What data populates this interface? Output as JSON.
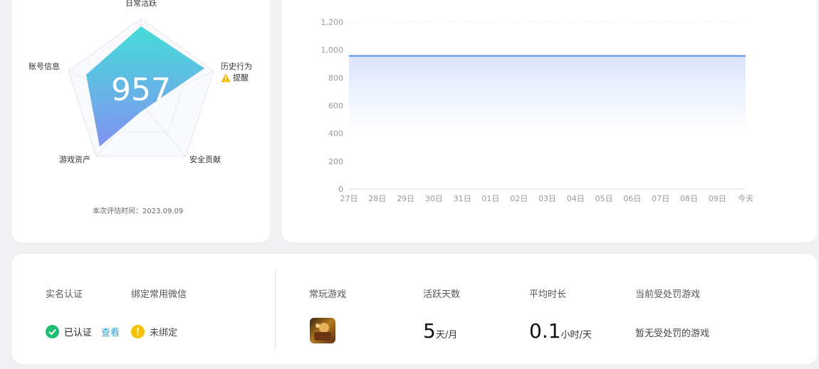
{
  "profile": {
    "score": "957",
    "radar_labels": {
      "daily_active": "日常活跃",
      "history": "历史行为",
      "reminder": "提醒",
      "security": "安全贡献",
      "assets": "游戏资产",
      "account": "账号信息"
    },
    "eval_date": "本次评估时间：2023.09.09",
    "colors": {
      "radar_top": "#3fdcd6",
      "radar_bottom": "#7e8ff2",
      "warning": "#f5b800"
    }
  },
  "chart_data": {
    "type": "area",
    "categories": [
      "27日",
      "28日",
      "29日",
      "30日",
      "31日",
      "01日",
      "02日",
      "03日",
      "04日",
      "05日",
      "06日",
      "07日",
      "08日",
      "09日",
      "今天"
    ],
    "series": [
      {
        "values": [
          957,
          957,
          957,
          957,
          957,
          957,
          957,
          957,
          957,
          957,
          957,
          957,
          957,
          957,
          957
        ]
      }
    ],
    "ylim": [
      0,
      1200
    ],
    "yticks": [
      "0",
      "200",
      "400",
      "600",
      "800",
      "1,000",
      "1,200"
    ],
    "grid": true,
    "line_color": "#5b8def"
  },
  "info": {
    "realname": {
      "header": "实名认证",
      "status": "已认证",
      "link": "查看"
    },
    "wechat": {
      "header": "绑定常用微信",
      "status": "未绑定"
    },
    "games": {
      "header": "常玩游戏"
    },
    "active_days": {
      "header": "活跃天数",
      "value": "5",
      "unit": "天/月"
    },
    "avg_duration": {
      "header": "平均时长",
      "value": "0.1",
      "unit": "小时/天"
    },
    "punishment": {
      "header": "当前受处罚游戏",
      "value": "暂无受处罚的游戏"
    },
    "colors": {
      "ok": "#1fbf73",
      "warn": "#f5c000",
      "link": "#2aa4d6"
    }
  }
}
